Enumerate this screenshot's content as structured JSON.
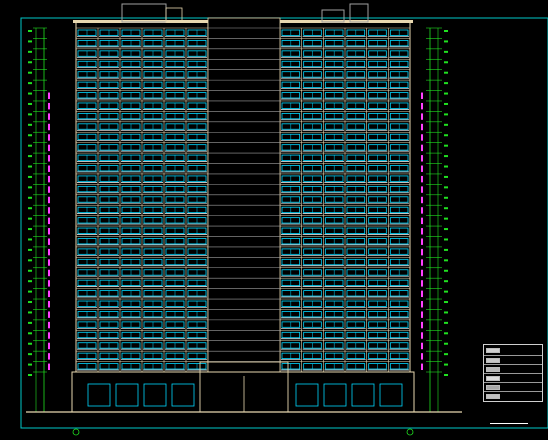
{
  "drawing": {
    "kind": "building-elevation",
    "colors": {
      "background": "#000000",
      "frame": "#00c8c8",
      "wall": "#e8d8b0",
      "window": "#00d8ff",
      "balcony": "#ffffff",
      "dimension": "#20e020",
      "level_marker": "#ff40ff",
      "roof": "#a0a0a0",
      "text": "#e0e0e0"
    },
    "floor_count": 33,
    "wing_count": 2
  },
  "legend": {
    "rows": [
      {
        "swatch": "#d0d0d0",
        "text": "",
        "code": ""
      },
      {
        "swatch": "#c8c8c8",
        "text": "",
        "code": ""
      },
      {
        "swatch": "#b8b8b8",
        "text": "",
        "code": ""
      },
      {
        "swatch": "#dcdcdc",
        "text": "",
        "code": ""
      },
      {
        "swatch": "#a8a8a8",
        "text": "",
        "code": ""
      },
      {
        "swatch": "#c0c0c0",
        "text": "",
        "code": ""
      }
    ]
  },
  "sheet_title": ""
}
